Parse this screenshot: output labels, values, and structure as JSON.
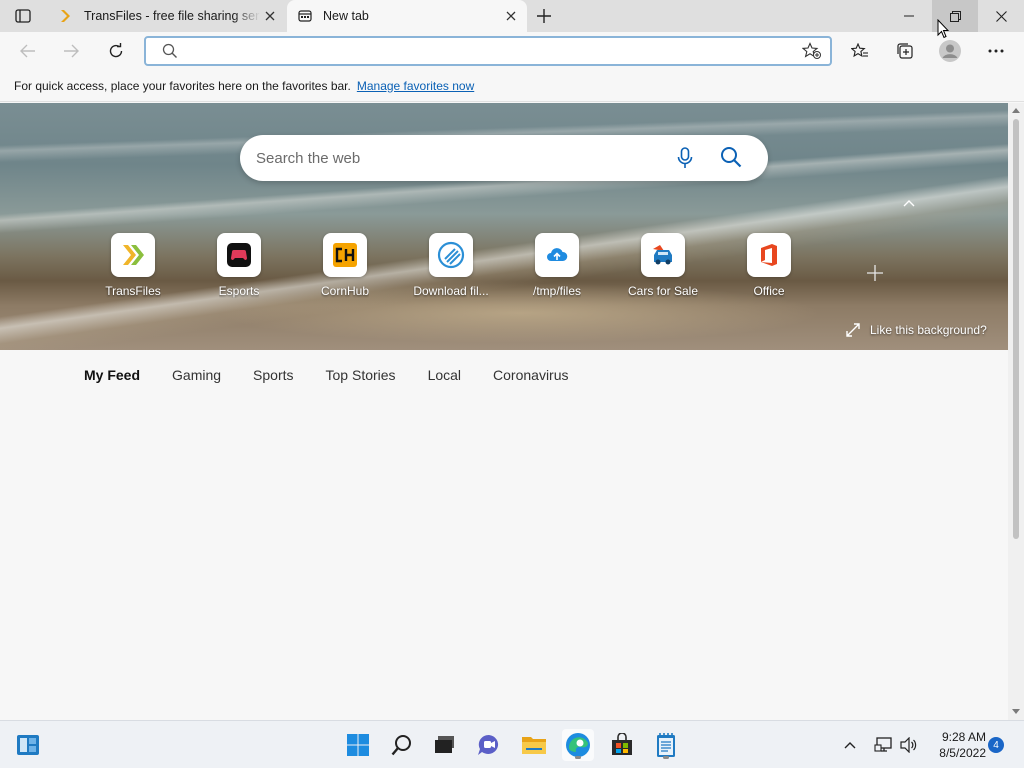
{
  "browser": {
    "tabs": [
      {
        "title": "TransFiles - free file sharing servi",
        "icon": "transfiles-chevron-icon",
        "active": false
      },
      {
        "title": "New tab",
        "icon": "new-tab-page-icon",
        "active": true
      }
    ],
    "address_bar": {
      "value": "",
      "placeholder": ""
    },
    "favorites_bar": {
      "message": "For quick access, place your favorites here on the favorites bar.",
      "link_label": "Manage favorites now"
    }
  },
  "new_tab": {
    "search_placeholder": "Search the web",
    "quick_links": [
      {
        "label": "TransFiles",
        "icon": "transfiles-icon",
        "color": "#e8a317"
      },
      {
        "label": "Esports",
        "icon": "gamepad-icon",
        "color": "#e03a5a"
      },
      {
        "label": "CornHub",
        "icon": "cornhub-icon",
        "color": "#f5a300"
      },
      {
        "label": "Download fil...",
        "icon": "download-files-icon",
        "color": "#2b8fd6"
      },
      {
        "label": "/tmp/files",
        "icon": "cloud-upload-icon",
        "color": "#1f8be0"
      },
      {
        "label": "Cars for Sale",
        "icon": "car-icon",
        "color": "#1f7ac2"
      },
      {
        "label": "Office",
        "icon": "office-icon",
        "color": "#e8471f"
      }
    ],
    "like_background_label": "Like this background?",
    "feed_tabs": [
      "My Feed",
      "Gaming",
      "Sports",
      "Top Stories",
      "Local",
      "Coronavirus"
    ],
    "active_feed_tab": "My Feed"
  },
  "taskbar": {
    "time": "9:28 AM",
    "date": "8/5/2022",
    "notification_count": "4",
    "apps": [
      "start-icon",
      "search-icon",
      "task-view-icon",
      "chat-icon",
      "file-explorer-icon",
      "edge-icon",
      "store-icon",
      "notepad-icon"
    ]
  },
  "colors": {
    "accent": "#0b61b5",
    "tabstrip_bg": "#dfdfdf",
    "taskbar_bg": "#eef1f5",
    "notification_badge": "#1a66c7"
  }
}
